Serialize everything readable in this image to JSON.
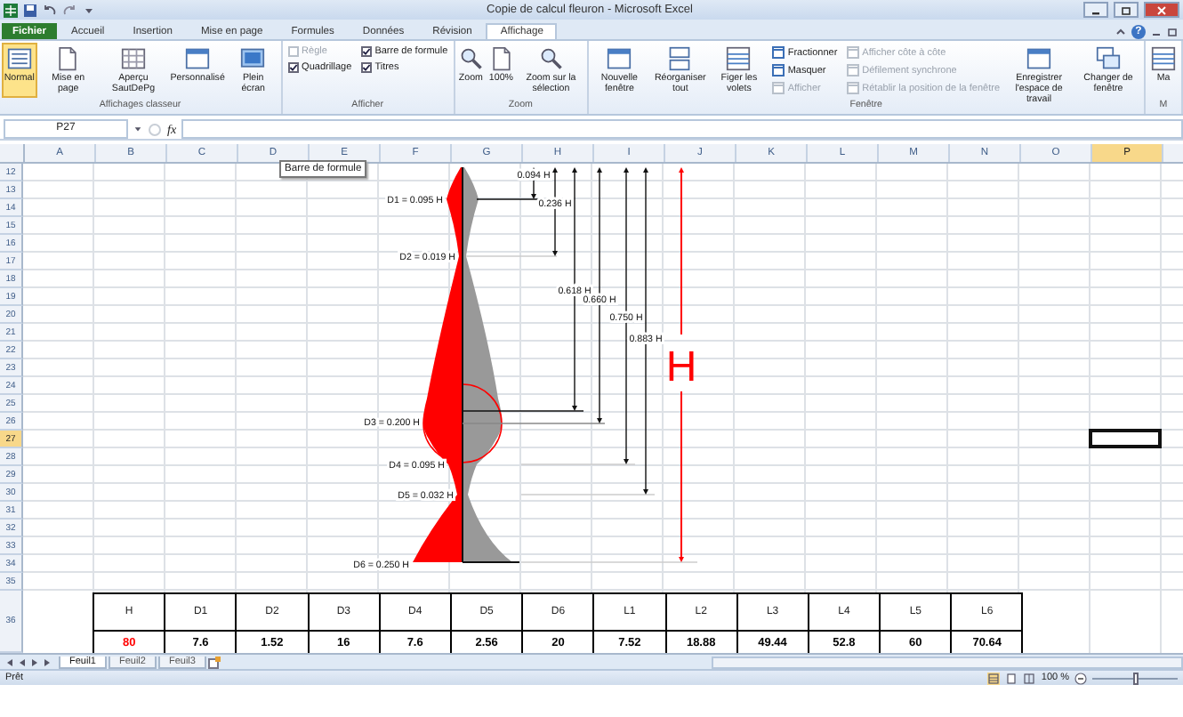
{
  "window": {
    "title": "Copie de calcul fleuron - Microsoft Excel"
  },
  "ribbon_tabs": [
    {
      "label": "Fichier",
      "selected": false,
      "kind": "file"
    },
    {
      "label": "Accueil",
      "selected": false,
      "kind": "tab"
    },
    {
      "label": "Insertion",
      "selected": false,
      "kind": "tab"
    },
    {
      "label": "Mise en page",
      "selected": false,
      "kind": "tab"
    },
    {
      "label": "Formules",
      "selected": false,
      "kind": "tab"
    },
    {
      "label": "Données",
      "selected": false,
      "kind": "tab"
    },
    {
      "label": "Révision",
      "selected": false,
      "kind": "tab"
    },
    {
      "label": "Affichage",
      "selected": true,
      "kind": "tab"
    }
  ],
  "ribbon_help": "?",
  "ribbon_groups": [
    {
      "label": "Affichages classeur",
      "items": [
        {
          "kind": "large",
          "label": "Normal",
          "selected": true
        },
        {
          "kind": "large",
          "label": "Mise en page",
          "selected": false
        },
        {
          "kind": "large",
          "label": "Aperçu SautDePg",
          "selected": false
        },
        {
          "kind": "large",
          "label": "Personnalisé",
          "selected": false
        },
        {
          "kind": "large",
          "label": "Plein écran",
          "selected": false
        }
      ]
    },
    {
      "label": "Afficher",
      "items": [
        {
          "kind": "stack",
          "items": [
            {
              "kind": "check",
              "label": "Règle",
              "checked": false,
              "disabled": true
            },
            {
              "kind": "check",
              "label": "Quadrillage",
              "checked": true,
              "disabled": false
            }
          ]
        },
        {
          "kind": "stack",
          "items": [
            {
              "kind": "check",
              "label": "Barre de formule",
              "checked": true,
              "disabled": false
            },
            {
              "kind": "check",
              "label": "Titres",
              "checked": true,
              "disabled": false
            }
          ]
        }
      ]
    },
    {
      "label": "Zoom",
      "items": [
        {
          "kind": "large",
          "label": "Zoom",
          "selected": false
        },
        {
          "kind": "large",
          "label": "100%",
          "selected": false
        },
        {
          "kind": "large",
          "label": "Zoom sur la sélection",
          "selected": false
        }
      ]
    },
    {
      "label": "Fenêtre",
      "items": [
        {
          "kind": "large",
          "label": "Nouvelle fenêtre",
          "selected": false
        },
        {
          "kind": "large",
          "label": "Réorganiser tout",
          "selected": false
        },
        {
          "kind": "large",
          "label": "Figer les volets",
          "selected": false
        },
        {
          "kind": "stack",
          "items": [
            {
              "kind": "small",
              "label": "Fractionner",
              "disabled": false
            },
            {
              "kind": "small",
              "label": "Masquer",
              "disabled": false
            },
            {
              "kind": "small",
              "label": "Afficher",
              "disabled": true
            }
          ]
        },
        {
          "kind": "stack",
          "items": [
            {
              "kind": "small",
              "label": "Afficher côte à côte",
              "disabled": true
            },
            {
              "kind": "small",
              "label": "Défilement synchrone",
              "disabled": true
            },
            {
              "kind": "small",
              "label": "Rétablir la position de la fenêtre",
              "disabled": true
            }
          ]
        },
        {
          "kind": "large",
          "label": "Enregistrer l'espace de travail",
          "selected": false
        },
        {
          "kind": "large",
          "label": "Changer de fenêtre",
          "selected": false
        }
      ]
    },
    {
      "label": "M",
      "items": [
        {
          "kind": "large",
          "label": "Ma",
          "selected": false
        }
      ]
    }
  ],
  "formula_bar": {
    "name_box": "P27",
    "function_label": "fx",
    "tooltip": "Barre de formule"
  },
  "columns": [
    {
      "label": "A",
      "selected": false
    },
    {
      "label": "B",
      "selected": false
    },
    {
      "label": "C",
      "selected": false
    },
    {
      "label": "D",
      "selected": false
    },
    {
      "label": "E",
      "selected": false
    },
    {
      "label": "F",
      "selected": false
    },
    {
      "label": "G",
      "selected": false
    },
    {
      "label": "H",
      "selected": false
    },
    {
      "label": "I",
      "selected": false
    },
    {
      "label": "J",
      "selected": false
    },
    {
      "label": "K",
      "selected": false
    },
    {
      "label": "L",
      "selected": false
    },
    {
      "label": "M",
      "selected": false
    },
    {
      "label": "N",
      "selected": false
    },
    {
      "label": "O",
      "selected": false
    },
    {
      "label": "P",
      "selected": true
    }
  ],
  "rows": [
    {
      "label": "12",
      "selected": false
    },
    {
      "label": "13",
      "selected": false
    },
    {
      "label": "14",
      "selected": false
    },
    {
      "label": "15",
      "selected": false
    },
    {
      "label": "16",
      "selected": false
    },
    {
      "label": "17",
      "selected": false
    },
    {
      "label": "18",
      "selected": false
    },
    {
      "label": "19",
      "selected": false
    },
    {
      "label": "20",
      "selected": false
    },
    {
      "label": "21",
      "selected": false
    },
    {
      "label": "22",
      "selected": false
    },
    {
      "label": "23",
      "selected": false
    },
    {
      "label": "24",
      "selected": false
    },
    {
      "label": "25",
      "selected": false
    },
    {
      "label": "26",
      "selected": false
    },
    {
      "label": "27",
      "selected": true
    },
    {
      "label": "28",
      "selected": false
    },
    {
      "label": "29",
      "selected": false
    },
    {
      "label": "30",
      "selected": false
    },
    {
      "label": "31",
      "selected": false
    },
    {
      "label": "32",
      "selected": false
    },
    {
      "label": "33",
      "selected": false
    },
    {
      "label": "34",
      "selected": false
    },
    {
      "label": "35",
      "selected": false
    },
    {
      "label": "36",
      "selected": false
    }
  ],
  "drawing": {
    "diameter_labels": [
      "D1 = 0.095 H",
      "D2 = 0.019 H",
      "D3 = 0.200 H",
      "D4 = 0.095 H",
      "D5 = 0.032 H",
      "D6 = 0.250 H"
    ],
    "length_labels": [
      "0.094 H",
      "0.236 H",
      "0.618 H",
      "0.660 H",
      "0.750 H",
      "0.883 H"
    ],
    "height_label": "H"
  },
  "table": {
    "columns": [
      "H",
      "D1",
      "D2",
      "D3",
      "D4",
      "D5",
      "D6",
      "L1",
      "L2",
      "L3",
      "L4",
      "L5",
      "L6"
    ],
    "rows": [
      {
        "cells": [
          {
            "text": "80",
            "color": "#ff0000"
          },
          {
            "text": "7.6",
            "color": "#000000"
          },
          {
            "text": "1.52",
            "color": "#000000"
          },
          {
            "text": "16",
            "color": "#000000"
          },
          {
            "text": "7.6",
            "color": "#000000"
          },
          {
            "text": "2.56",
            "color": "#000000"
          },
          {
            "text": "20",
            "color": "#000000"
          },
          {
            "text": "7.52",
            "color": "#000000"
          },
          {
            "text": "18.88",
            "color": "#000000"
          },
          {
            "text": "49.44",
            "color": "#000000"
          },
          {
            "text": "52.8",
            "color": "#000000"
          },
          {
            "text": "60",
            "color": "#000000"
          },
          {
            "text": "70.64",
            "color": "#000000"
          }
        ]
      }
    ]
  },
  "sheet_tabs": [
    {
      "label": "Feuil1",
      "selected": true
    },
    {
      "label": "Feuil2",
      "selected": false
    },
    {
      "label": "Feuil3",
      "selected": false
    }
  ],
  "status_bar": {
    "status": "Prêt",
    "zoom_text": "100 %",
    "zoom_slider": {
      "level": 0.5
    }
  }
}
